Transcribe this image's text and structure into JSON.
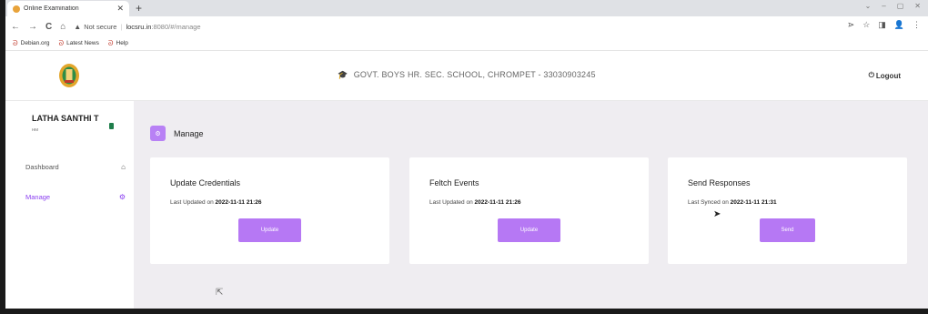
{
  "browser": {
    "tab_title": "Online Examination",
    "tab_close": "✕",
    "new_tab": "+",
    "window_controls": [
      "⌄",
      "–",
      "▢",
      "✕"
    ],
    "nav": {
      "back": "←",
      "forward": "→",
      "reload": "C",
      "home": "⌂"
    },
    "not_secure": "Not secure",
    "url_host": "locsru.in",
    "url_path": ":8080/#/manage",
    "toolbar_icons": [
      "⋗",
      "☆",
      "◨",
      "👤",
      "⋮"
    ],
    "bookmarks": [
      {
        "label": "Debian.org",
        "icon": "debian-swirl-icon"
      },
      {
        "label": "Latest News",
        "icon": "debian-swirl-icon"
      },
      {
        "label": "Help",
        "icon": "debian-swirl-icon"
      }
    ]
  },
  "header": {
    "school": "GOVT. BOYS HR. SEC. SCHOOL, CHROMPET - 33030903245",
    "logout": "Logout"
  },
  "sidebar": {
    "user_name": "LATHA SANTHI T",
    "user_role": "HM",
    "items": [
      {
        "label": "Dashboard",
        "icon": "home-icon",
        "glyph": "⌂",
        "active": false
      },
      {
        "label": "Manage",
        "icon": "gear-icon",
        "glyph": "⚙",
        "active": true
      }
    ]
  },
  "main": {
    "page_title": "Manage",
    "cards": [
      {
        "title": "Update Credentials",
        "meta_label": "Last Updated on",
        "meta_value": "2022-11-11 21:26",
        "button": "Update"
      },
      {
        "title": "Feltch Events",
        "meta_label": "Last Updated on",
        "meta_value": "2022-11-11 21:26",
        "button": "Update"
      },
      {
        "title": "Send Responses",
        "meta_label": "Last Synced on",
        "meta_value": "2022-11-11 21:31",
        "button": "Send"
      }
    ]
  },
  "colors": {
    "accent": "#b678f4",
    "active_menu": "#8a3ff0",
    "main_bg": "#efedf1"
  }
}
